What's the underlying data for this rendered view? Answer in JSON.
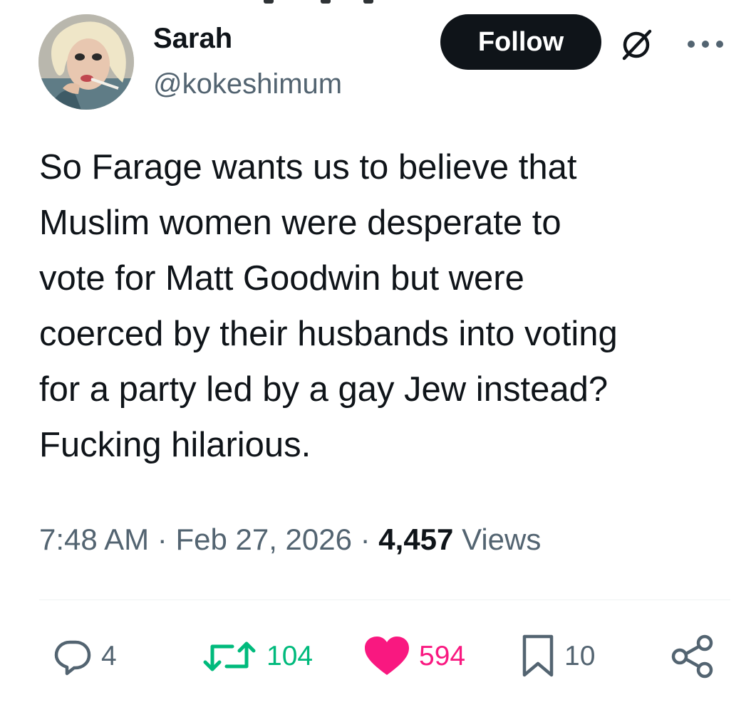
{
  "author": {
    "display_name": "Sarah",
    "handle": "@kokeshimum",
    "avatar_icon": "profile-photo"
  },
  "actions_top": {
    "follow_label": "Follow",
    "grok_icon": "grok-icon",
    "more_icon": "more-icon"
  },
  "tweet": {
    "text": "So Farage wants us to believe that\nMuslim women were desperate to\nvote for Matt Goodwin but were\ncoerced by their husbands into voting\nfor a party led by a gay Jew instead?\nFucking hilarious."
  },
  "meta": {
    "time": "7:48 AM",
    "separator": " · ",
    "date": "Feb 27, 2026",
    "views_count": "4,457",
    "views_label": " Views"
  },
  "engagement": {
    "replies": "4",
    "retweets": "104",
    "likes": "594",
    "bookmarks": "10"
  },
  "colors": {
    "text_primary": "#0f1419",
    "text_secondary": "#536471",
    "retweet_green": "#00ba7c",
    "like_pink": "#f91880",
    "follow_bg": "#0f1419"
  }
}
